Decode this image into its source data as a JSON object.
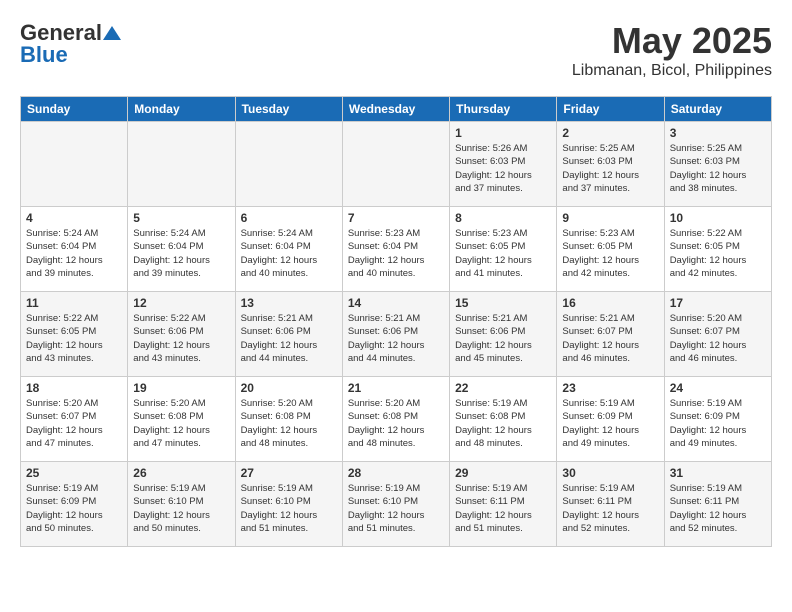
{
  "header": {
    "logo_general": "General",
    "logo_blue": "Blue",
    "month": "May 2025",
    "location": "Libmanan, Bicol, Philippines"
  },
  "days_of_week": [
    "Sunday",
    "Monday",
    "Tuesday",
    "Wednesday",
    "Thursday",
    "Friday",
    "Saturday"
  ],
  "weeks": [
    [
      {
        "day": "",
        "info": ""
      },
      {
        "day": "",
        "info": ""
      },
      {
        "day": "",
        "info": ""
      },
      {
        "day": "",
        "info": ""
      },
      {
        "day": "1",
        "info": "Sunrise: 5:26 AM\nSunset: 6:03 PM\nDaylight: 12 hours\nand 37 minutes."
      },
      {
        "day": "2",
        "info": "Sunrise: 5:25 AM\nSunset: 6:03 PM\nDaylight: 12 hours\nand 37 minutes."
      },
      {
        "day": "3",
        "info": "Sunrise: 5:25 AM\nSunset: 6:03 PM\nDaylight: 12 hours\nand 38 minutes."
      }
    ],
    [
      {
        "day": "4",
        "info": "Sunrise: 5:24 AM\nSunset: 6:04 PM\nDaylight: 12 hours\nand 39 minutes."
      },
      {
        "day": "5",
        "info": "Sunrise: 5:24 AM\nSunset: 6:04 PM\nDaylight: 12 hours\nand 39 minutes."
      },
      {
        "day": "6",
        "info": "Sunrise: 5:24 AM\nSunset: 6:04 PM\nDaylight: 12 hours\nand 40 minutes."
      },
      {
        "day": "7",
        "info": "Sunrise: 5:23 AM\nSunset: 6:04 PM\nDaylight: 12 hours\nand 40 minutes."
      },
      {
        "day": "8",
        "info": "Sunrise: 5:23 AM\nSunset: 6:05 PM\nDaylight: 12 hours\nand 41 minutes."
      },
      {
        "day": "9",
        "info": "Sunrise: 5:23 AM\nSunset: 6:05 PM\nDaylight: 12 hours\nand 42 minutes."
      },
      {
        "day": "10",
        "info": "Sunrise: 5:22 AM\nSunset: 6:05 PM\nDaylight: 12 hours\nand 42 minutes."
      }
    ],
    [
      {
        "day": "11",
        "info": "Sunrise: 5:22 AM\nSunset: 6:05 PM\nDaylight: 12 hours\nand 43 minutes."
      },
      {
        "day": "12",
        "info": "Sunrise: 5:22 AM\nSunset: 6:06 PM\nDaylight: 12 hours\nand 43 minutes."
      },
      {
        "day": "13",
        "info": "Sunrise: 5:21 AM\nSunset: 6:06 PM\nDaylight: 12 hours\nand 44 minutes."
      },
      {
        "day": "14",
        "info": "Sunrise: 5:21 AM\nSunset: 6:06 PM\nDaylight: 12 hours\nand 44 minutes."
      },
      {
        "day": "15",
        "info": "Sunrise: 5:21 AM\nSunset: 6:06 PM\nDaylight: 12 hours\nand 45 minutes."
      },
      {
        "day": "16",
        "info": "Sunrise: 5:21 AM\nSunset: 6:07 PM\nDaylight: 12 hours\nand 46 minutes."
      },
      {
        "day": "17",
        "info": "Sunrise: 5:20 AM\nSunset: 6:07 PM\nDaylight: 12 hours\nand 46 minutes."
      }
    ],
    [
      {
        "day": "18",
        "info": "Sunrise: 5:20 AM\nSunset: 6:07 PM\nDaylight: 12 hours\nand 47 minutes."
      },
      {
        "day": "19",
        "info": "Sunrise: 5:20 AM\nSunset: 6:08 PM\nDaylight: 12 hours\nand 47 minutes."
      },
      {
        "day": "20",
        "info": "Sunrise: 5:20 AM\nSunset: 6:08 PM\nDaylight: 12 hours\nand 48 minutes."
      },
      {
        "day": "21",
        "info": "Sunrise: 5:20 AM\nSunset: 6:08 PM\nDaylight: 12 hours\nand 48 minutes."
      },
      {
        "day": "22",
        "info": "Sunrise: 5:19 AM\nSunset: 6:08 PM\nDaylight: 12 hours\nand 48 minutes."
      },
      {
        "day": "23",
        "info": "Sunrise: 5:19 AM\nSunset: 6:09 PM\nDaylight: 12 hours\nand 49 minutes."
      },
      {
        "day": "24",
        "info": "Sunrise: 5:19 AM\nSunset: 6:09 PM\nDaylight: 12 hours\nand 49 minutes."
      }
    ],
    [
      {
        "day": "25",
        "info": "Sunrise: 5:19 AM\nSunset: 6:09 PM\nDaylight: 12 hours\nand 50 minutes."
      },
      {
        "day": "26",
        "info": "Sunrise: 5:19 AM\nSunset: 6:10 PM\nDaylight: 12 hours\nand 50 minutes."
      },
      {
        "day": "27",
        "info": "Sunrise: 5:19 AM\nSunset: 6:10 PM\nDaylight: 12 hours\nand 51 minutes."
      },
      {
        "day": "28",
        "info": "Sunrise: 5:19 AM\nSunset: 6:10 PM\nDaylight: 12 hours\nand 51 minutes."
      },
      {
        "day": "29",
        "info": "Sunrise: 5:19 AM\nSunset: 6:11 PM\nDaylight: 12 hours\nand 51 minutes."
      },
      {
        "day": "30",
        "info": "Sunrise: 5:19 AM\nSunset: 6:11 PM\nDaylight: 12 hours\nand 52 minutes."
      },
      {
        "day": "31",
        "info": "Sunrise: 5:19 AM\nSunset: 6:11 PM\nDaylight: 12 hours\nand 52 minutes."
      }
    ]
  ]
}
